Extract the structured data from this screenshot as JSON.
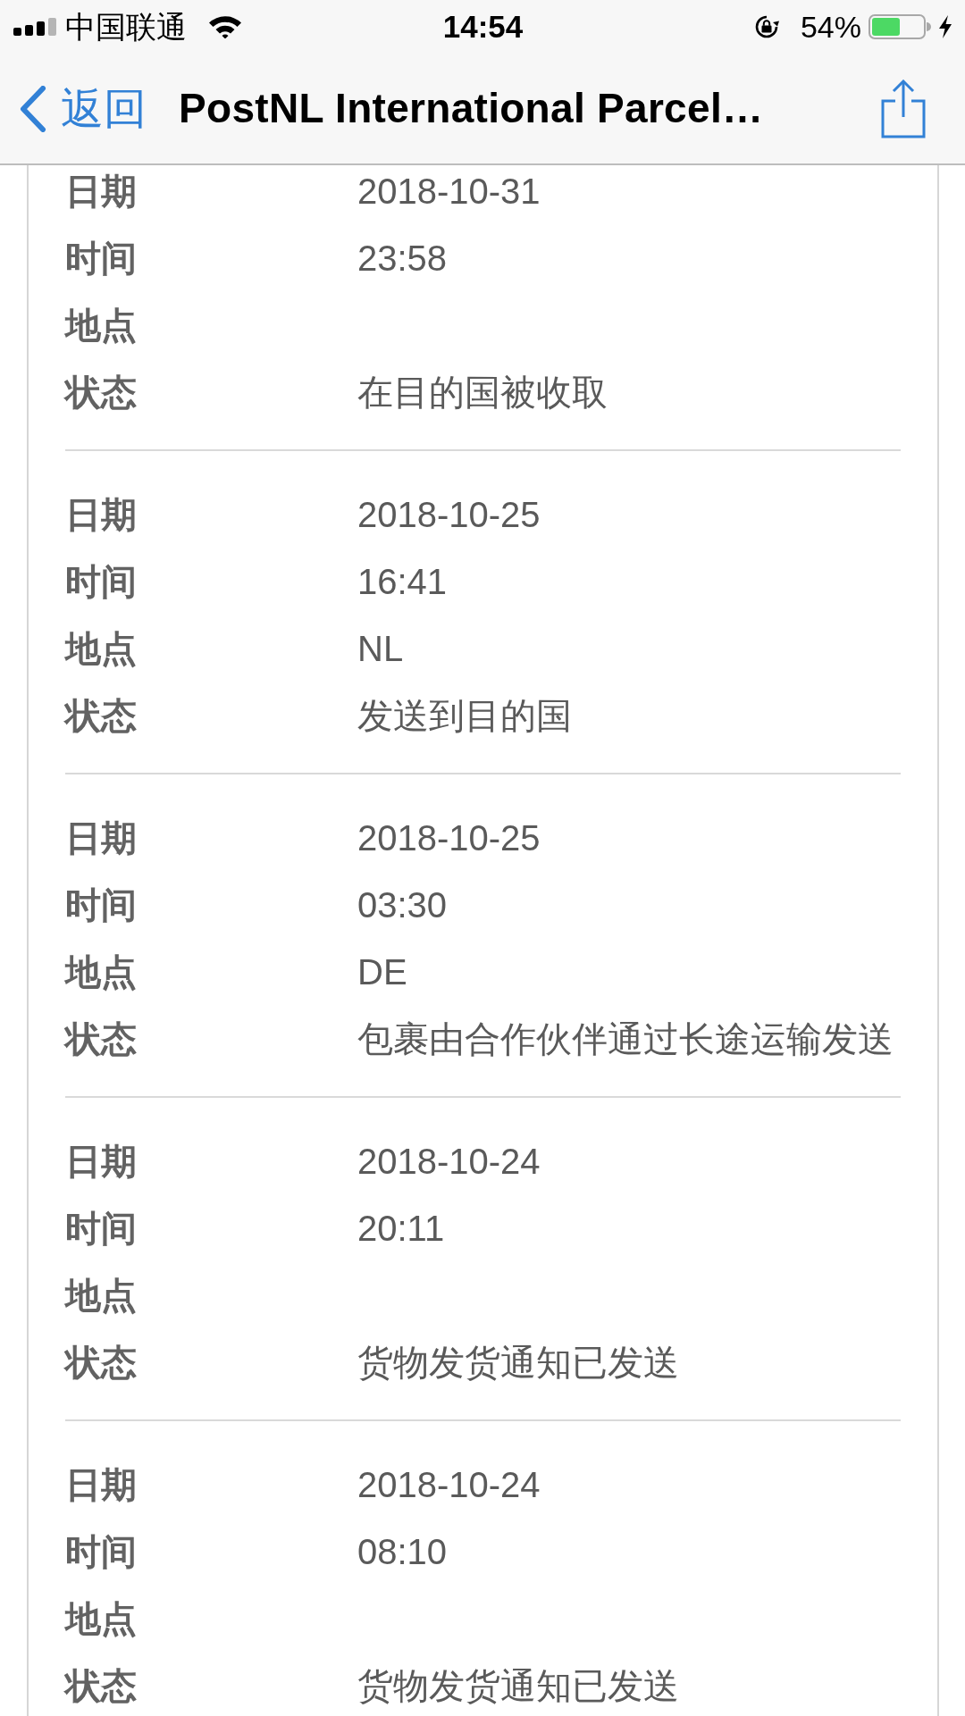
{
  "status_bar": {
    "carrier": "中国联通",
    "time": "14:54",
    "battery": "54%"
  },
  "nav_bar": {
    "back_label": "返回",
    "title": "PostNL International Parcel…"
  },
  "events": [
    {
      "fields": [
        {
          "label": "日期",
          "value": "2018-10-31"
        },
        {
          "label": "时间",
          "value": "23:58"
        },
        {
          "label": "地点"
        },
        {
          "label": "状态",
          "value": "在目的国被收取"
        }
      ]
    },
    {
      "fields": [
        {
          "label": "日期",
          "value": "2018-10-25"
        },
        {
          "label": "时间",
          "value": "16:41"
        },
        {
          "label": "地点",
          "value": "NL"
        },
        {
          "label": "状态",
          "value": "发送到目的国"
        }
      ]
    },
    {
      "fields": [
        {
          "label": "日期",
          "value": "2018-10-25"
        },
        {
          "label": "时间",
          "value": "03:30"
        },
        {
          "label": "地点",
          "value": "DE"
        },
        {
          "label": "状态",
          "value": "包裹由合作伙伴通过长途运输发送"
        }
      ]
    },
    {
      "fields": [
        {
          "label": "日期",
          "value": "2018-10-24"
        },
        {
          "label": "时间",
          "value": "20:11"
        },
        {
          "label": "地点"
        },
        {
          "label": "状态",
          "value": "货物发货通知已发送"
        }
      ]
    },
    {
      "fields": [
        {
          "label": "日期",
          "value": "2018-10-24"
        },
        {
          "label": "时间",
          "value": "08:10"
        },
        {
          "label": "地点"
        },
        {
          "label": "状态",
          "value": "货物发货通知已发送"
        }
      ]
    }
  ]
}
